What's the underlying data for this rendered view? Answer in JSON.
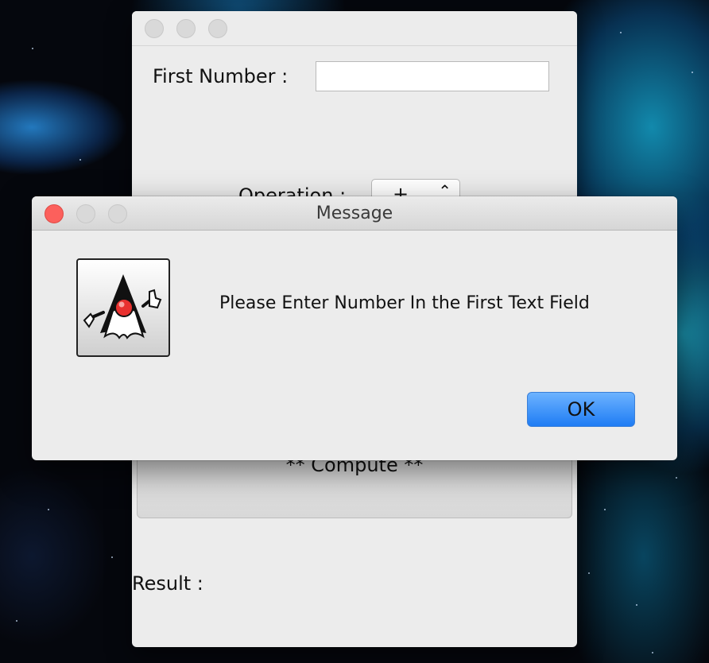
{
  "main_window": {
    "first_number_label": "First Number :",
    "first_number_value": "",
    "operation_label": "Operation :",
    "operation_selected": "+",
    "compute_label": "** Compute **",
    "result_label": "Result :"
  },
  "dialog": {
    "title": "Message",
    "message": "Please Enter Number In the First Text Field",
    "ok_label": "OK",
    "icon": "java-duke-icon"
  },
  "colors": {
    "ok_button": "#1e7cf4",
    "close_button": "#fc605c",
    "window_bg": "#ececec"
  }
}
